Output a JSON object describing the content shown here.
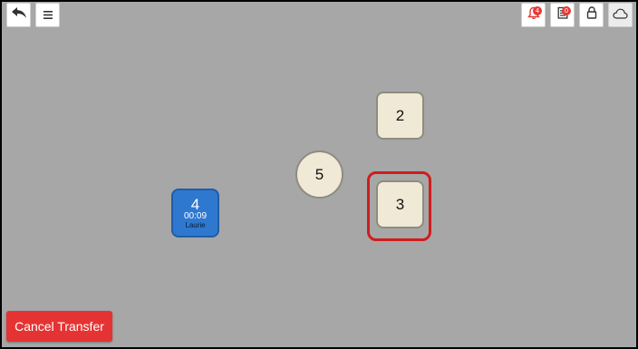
{
  "toolbar": {
    "back_icon": "back-arrow-icon",
    "menu_icon": "hamburger-menu-icon",
    "notifications": {
      "icon": "bell-icon",
      "count": "4",
      "color": "#e53935"
    },
    "orders": {
      "icon": "receipt-icon",
      "count": "0"
    },
    "lock_icon": "lock-icon",
    "cloud_icon": "cloud-icon"
  },
  "tables": [
    {
      "id": "table-2",
      "number": "2",
      "shape": "square"
    },
    {
      "id": "table-5",
      "number": "5",
      "shape": "round"
    },
    {
      "id": "table-3",
      "number": "3",
      "shape": "square",
      "selected": true
    },
    {
      "id": "table-4",
      "number": "4",
      "shape": "square",
      "active": true,
      "timer": "00:09",
      "server": "Laurie"
    }
  ],
  "footer": {
    "cancel_label": "Cancel Transfer"
  },
  "colors": {
    "floor": "#a7a7a7",
    "table": "#efe9d6",
    "active_table": "#2f78d0",
    "selection": "#d11c1c",
    "cancel": "#e53333"
  }
}
